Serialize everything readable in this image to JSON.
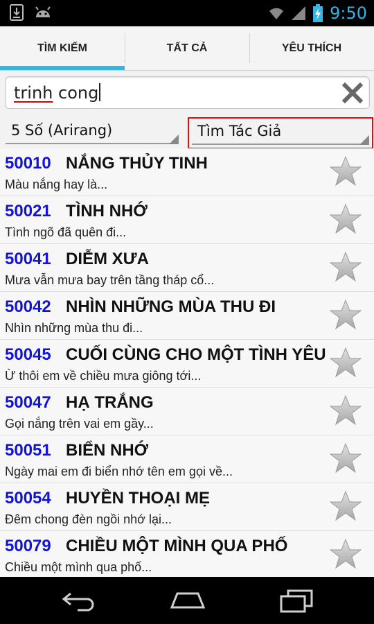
{
  "status_bar": {
    "time": "9:50",
    "icons": [
      "download-icon",
      "android-icon",
      "wifi-icon",
      "signal-icon",
      "battery-charging-icon"
    ],
    "accent": "#33b5e5"
  },
  "tabs": [
    {
      "label": "TÌM KIẾM",
      "active": true
    },
    {
      "label": "TẤT CẢ",
      "active": false
    },
    {
      "label": "YÊU THÍCH",
      "active": false
    }
  ],
  "search": {
    "value_word1": "trinh",
    "value_word2": " cong",
    "clear_icon": "clear-x-icon"
  },
  "filters": {
    "type_selected": "5 Số (Arirang)",
    "mode_selected": "Tìm Tác Giả",
    "highlight_color": "#e01010"
  },
  "songs": [
    {
      "number": "50010",
      "title": "NẮNG THỦY TINH",
      "lyric": "Màu nắng hay là..."
    },
    {
      "number": "50021",
      "title": "TÌNH NHỚ",
      "lyric": "Tình ngõ đã quên đi..."
    },
    {
      "number": "50041",
      "title": "DIỄM XƯA",
      "lyric": "Mưa vẫn mưa bay trên tầng tháp cổ..."
    },
    {
      "number": "50042",
      "title": "NHÌN NHỮNG MÙA THU ĐI",
      "lyric": "Nhìn những mùa thu đi..."
    },
    {
      "number": "50045",
      "title": "CUỐI CÙNG CHO MỘT TÌNH YÊU",
      "lyric": "Ừ thôi em về chiều mưa giông tới..."
    },
    {
      "number": "50047",
      "title": "HẠ TRẮNG",
      "lyric": "Gọi nắng trên vai em gầy..."
    },
    {
      "number": "50051",
      "title": "BIỂN NHỚ",
      "lyric": "Ngày mai em đi biển nhớ tên em gọi về..."
    },
    {
      "number": "50054",
      "title": "HUYỀN THOẠI MẸ",
      "lyric": "Đêm chong đèn ngồi nhớ lại..."
    },
    {
      "number": "50079",
      "title": "CHIỀU MỘT MÌNH QUA PHỐ",
      "lyric": "Chiều một mình qua phố..."
    }
  ],
  "colors": {
    "song_number": "#1212d8",
    "star": "#c8c8c8"
  },
  "nav_bar": {
    "icons": [
      "back-icon",
      "home-icon",
      "recent-apps-icon"
    ]
  }
}
